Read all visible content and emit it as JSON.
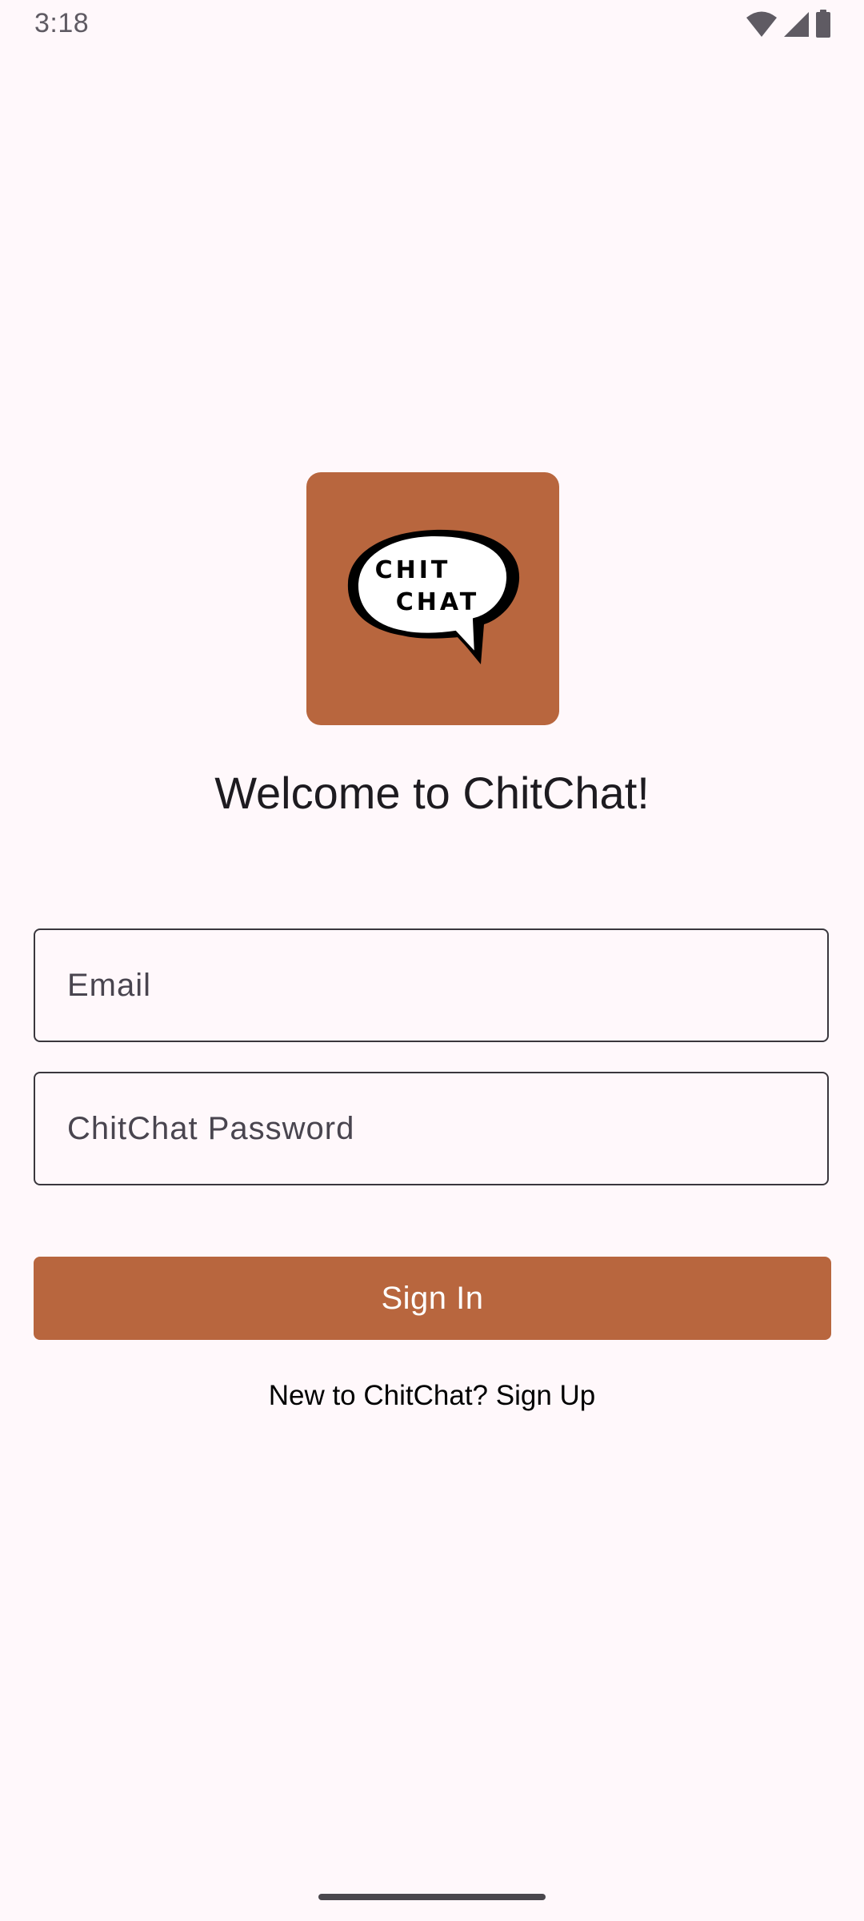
{
  "status_bar": {
    "time": "3:18",
    "icons": [
      "wifi-icon",
      "cell-signal-icon",
      "battery-icon"
    ]
  },
  "app": {
    "logo": {
      "line1": "CHIT",
      "line2": "CHAT",
      "background_color": "#b8663e"
    },
    "welcome_title": "Welcome to ChitChat!"
  },
  "form": {
    "email": {
      "placeholder": "Email",
      "value": ""
    },
    "password": {
      "placeholder": "ChitChat Password",
      "value": ""
    },
    "sign_in_label": "Sign In",
    "sign_up_label": "New to ChitChat? Sign Up"
  },
  "colors": {
    "accent": "#b8663e",
    "background": "#fff8fb",
    "outline": "#3a373d"
  }
}
